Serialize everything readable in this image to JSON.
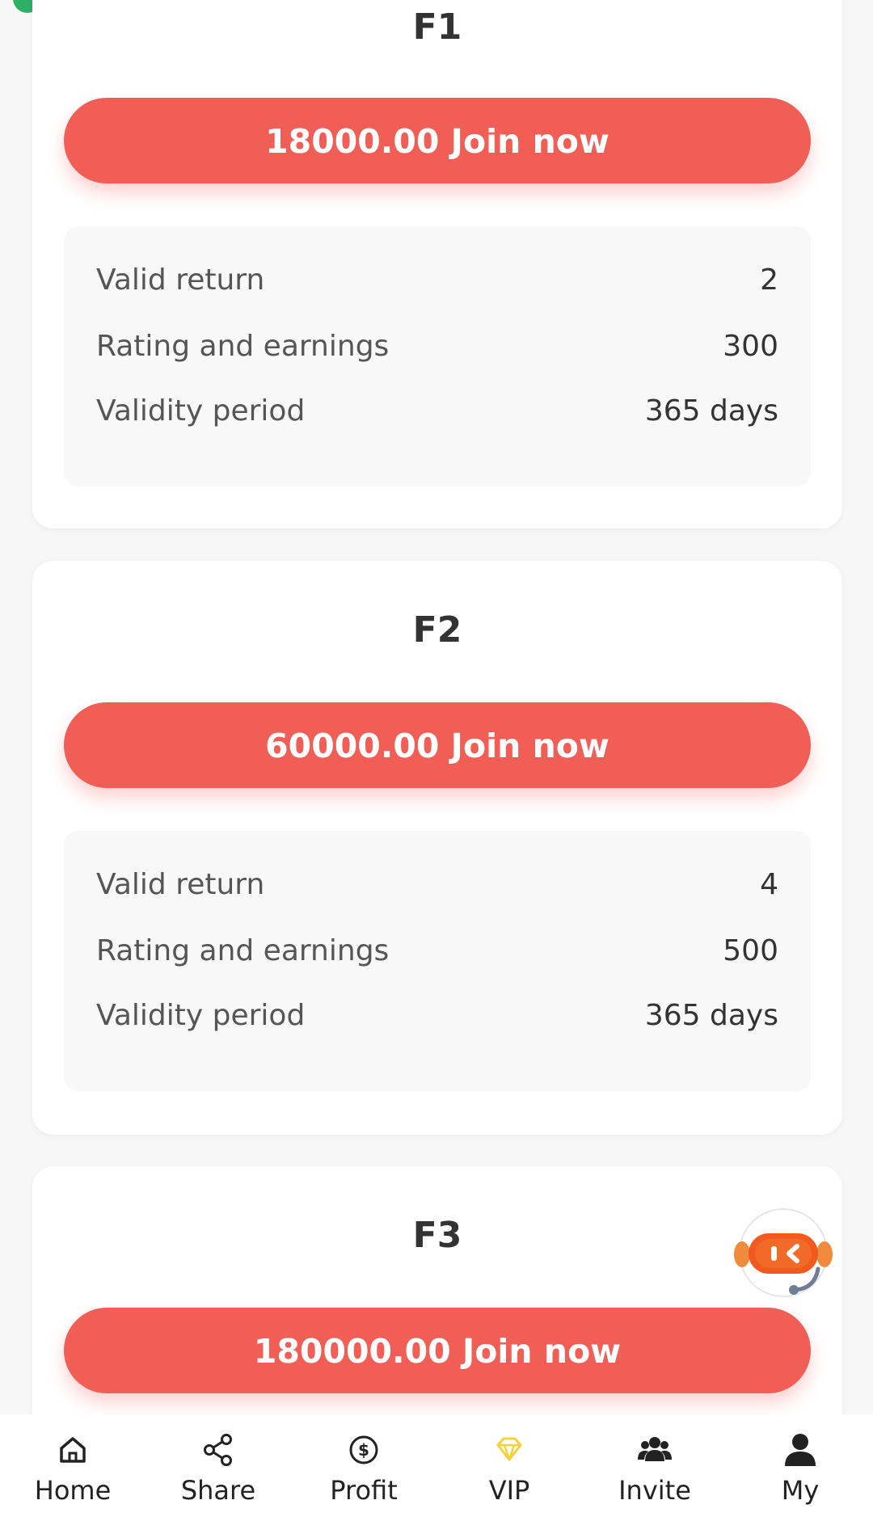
{
  "plans": [
    {
      "title": "F1",
      "button_label": "18000.00 Join now",
      "rows": [
        {
          "label": "Valid return",
          "value": "2"
        },
        {
          "label": "Rating and earnings",
          "value": "300"
        },
        {
          "label": "Validity period",
          "value": "365 days"
        }
      ]
    },
    {
      "title": "F2",
      "button_label": "60000.00 Join now",
      "rows": [
        {
          "label": "Valid return",
          "value": "4"
        },
        {
          "label": "Rating and earnings",
          "value": "500"
        },
        {
          "label": "Validity period",
          "value": "365 days"
        }
      ]
    },
    {
      "title": "F3",
      "button_label": "180000.00 Join now"
    }
  ],
  "tabs": [
    {
      "label": "Home",
      "icon": "home-icon"
    },
    {
      "label": "Share",
      "icon": "share-icon"
    },
    {
      "label": "Profit",
      "icon": "dollar-circle-icon"
    },
    {
      "label": "VIP",
      "icon": "diamond-icon",
      "color": "#f5d23b"
    },
    {
      "label": "Invite",
      "icon": "users-icon"
    },
    {
      "label": "My",
      "icon": "person-icon"
    }
  ],
  "colors": {
    "accent": "#f05e56",
    "background": "#f7f7f7",
    "card": "#ffffff",
    "info_box": "#f8f8f8"
  }
}
